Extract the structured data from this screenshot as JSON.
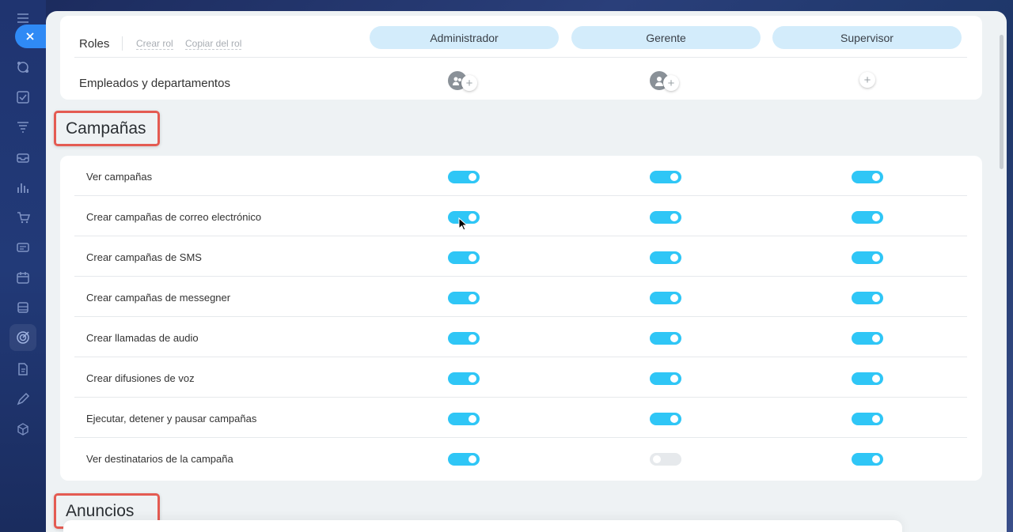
{
  "sidebar": {
    "close_icon": "close-icon",
    "items": [
      {
        "icon": "menu-icon"
      },
      {
        "icon": "flow-icon"
      },
      {
        "icon": "tasks-icon"
      },
      {
        "icon": "filter-icon"
      },
      {
        "icon": "inbox-icon"
      },
      {
        "icon": "chart-icon"
      },
      {
        "icon": "cart-icon"
      },
      {
        "icon": "card-icon"
      },
      {
        "icon": "calendar-icon"
      },
      {
        "icon": "archive-icon"
      },
      {
        "icon": "target-icon"
      },
      {
        "icon": "document-icon"
      },
      {
        "icon": "pen-icon"
      },
      {
        "icon": "cube-icon"
      }
    ]
  },
  "roles": {
    "label": "Roles",
    "create_role": "Crear rol",
    "copy_role": "Copiar del rol",
    "columns": [
      "Administrador",
      "Gerente",
      "Supervisor"
    ],
    "employees_label": "Empleados y departamentos"
  },
  "sections": {
    "campaigns_title": "Campañas",
    "ads_title": "Anuncios"
  },
  "permissions": [
    {
      "label": "Ver campañas",
      "values": [
        true,
        true,
        true
      ]
    },
    {
      "label": "Crear campañas de correo electrónico",
      "values": [
        true,
        true,
        true
      ]
    },
    {
      "label": "Crear campañas de SMS",
      "values": [
        true,
        true,
        true
      ]
    },
    {
      "label": "Crear campañas de messegner",
      "values": [
        true,
        true,
        true
      ]
    },
    {
      "label": "Crear llamadas de audio",
      "values": [
        true,
        true,
        true
      ]
    },
    {
      "label": "Crear difusiones de voz",
      "values": [
        true,
        true,
        true
      ]
    },
    {
      "label": "Ejecutar, detener y pausar campañas",
      "values": [
        true,
        true,
        true
      ]
    },
    {
      "label": "Ver destinatarios de la campaña",
      "values": [
        true,
        false,
        true
      ]
    }
  ],
  "colors": {
    "toggle_on": "#2fc6f6",
    "toggle_off": "#e6e9ec",
    "role_pill": "#d3ecfb",
    "highlight_border": "#e45b52",
    "close_button": "#2f8af5"
  }
}
